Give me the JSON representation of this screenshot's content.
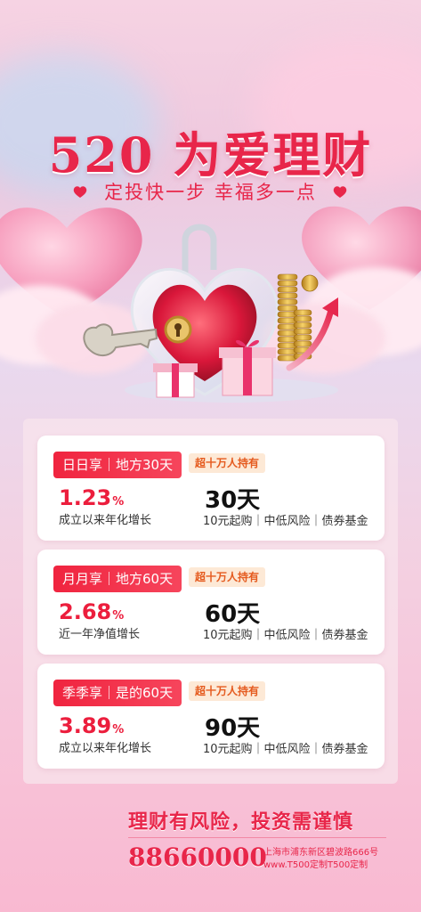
{
  "title": "520 为爱理财",
  "subtitle": "定投快一步 幸福多一点",
  "products": [
    {
      "tag": "日日享｜地方30天",
      "holders": "超十万人持有",
      "rate": "1.23",
      "rate_unit": "%",
      "rate_label": "成立以来年化增长",
      "days": "30天",
      "meta": "10元起购｜中低风险｜债券基金"
    },
    {
      "tag": "月月享｜地方60天",
      "holders": "超十万人持有",
      "rate": "2.68",
      "rate_unit": "%",
      "rate_label": "近一年净值增长",
      "days": "60天",
      "meta": "10元起购｜中低风险｜债券基金"
    },
    {
      "tag": "季季享｜是的60天",
      "holders": "超十万人持有",
      "rate": "3.89",
      "rate_unit": "%",
      "rate_label": "成立以来年化增长",
      "days": "90天",
      "meta": "10元起购｜中低风险｜债券基金"
    }
  ],
  "footer": {
    "risk_notice": "理财有风险，投资需谨慎",
    "phone": "88660000",
    "address_line1": "上海市浦东新区碧波路666号",
    "address_line2": "www.T500定制T500定制"
  },
  "colors": {
    "primary_red": "#e8264a",
    "tag_red": "#f0243f",
    "holders_bg": "#fde9d6",
    "holders_text": "#e55b1f"
  },
  "icons": [
    "heart-icon",
    "lock-heart-illustration",
    "key-icon",
    "gift-box-icon",
    "gold-coins-icon",
    "growth-arrow-icon"
  ]
}
